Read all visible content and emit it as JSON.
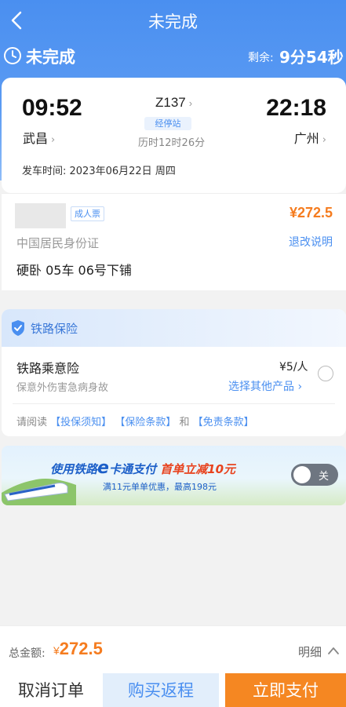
{
  "nav": {
    "title": "未完成"
  },
  "status": {
    "text": "未完成",
    "remaining_label": "剩余:",
    "remaining_time": "9分54秒"
  },
  "trip": {
    "departure_time": "09:52",
    "arrival_time": "22:18",
    "departure_station": "武昌",
    "arrival_station": "广州",
    "train_number": "Z137",
    "stops_badge": "经停站",
    "duration": "历时12时26分",
    "depart_date": "发车时间: 2023年06月22日 周四"
  },
  "passenger": {
    "ticket_type": "成人票",
    "price": "¥272.5",
    "id_type": "中国居民身份证",
    "refund_link": "退改说明",
    "seat": "硬卧 05车 06号下铺"
  },
  "insurance": {
    "title": "铁路保险",
    "product_name": "铁路乘意险",
    "product_price": "¥5/人",
    "product_desc": "保意外伤害急病身故",
    "other_products": "选择其他产品 ›",
    "terms_prefix": "请阅读",
    "terms_link1": "【投保须知】",
    "terms_link2": "【保险条款】",
    "terms_and": "和",
    "terms_link3": "【免责条款】"
  },
  "promo": {
    "line1_a": "使用铁路",
    "line1_e": "e",
    "line1_b": "卡通支付",
    "line1_highlight": "首单立减10元",
    "line2": "满11元单单优惠，最高198元",
    "toggle_label": "关",
    "toggle_on": false
  },
  "bottom": {
    "total_label": "总金额:",
    "total_currency": "¥",
    "total_amount": "272.5",
    "detail_label": "明细",
    "cancel_label": "取消订单",
    "return_label": "购买返程",
    "pay_label": "立即支付"
  },
  "colors": {
    "primary": "#4a8ff0",
    "accent_orange": "#f57c1f",
    "pay_button": "#f58722"
  },
  "icons": {
    "back": "chevron-left-icon",
    "clock": "clock-icon",
    "shield": "shield-icon",
    "detail": "chevron-up-icon"
  }
}
